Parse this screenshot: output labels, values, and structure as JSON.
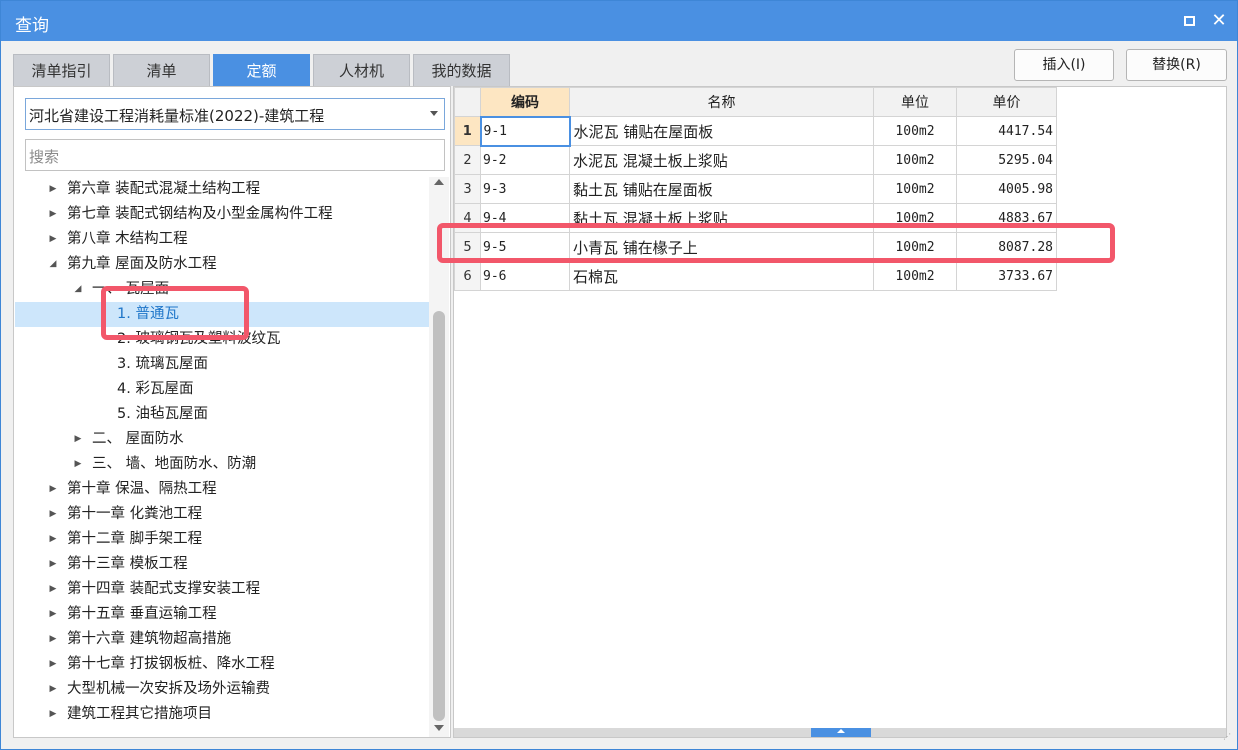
{
  "window": {
    "title": "查询",
    "maximize_icon": "maximize-icon",
    "close_icon": "close-icon",
    "close_glyph": "✕",
    "accent": "#4a90e2",
    "highlight_color": "#f2576a"
  },
  "tabs": [
    {
      "label": "清单指引",
      "active": false
    },
    {
      "label": "清单",
      "active": false
    },
    {
      "label": "定额",
      "active": true
    },
    {
      "label": "人材机",
      "active": false
    },
    {
      "label": "我的数据",
      "active": false
    }
  ],
  "buttons": {
    "insert": "插入(I)",
    "replace": "替换(R)"
  },
  "left": {
    "standard_select": "河北省建设工程消耗量标准(2022)-建筑工程",
    "search_placeholder": "搜索",
    "tree": [
      {
        "label": "第六章 装配式混凝土结构工程",
        "level": 0,
        "expanded": false
      },
      {
        "label": "第七章 装配式钢结构及小型金属构件工程",
        "level": 0,
        "expanded": false
      },
      {
        "label": "第八章 木结构工程",
        "level": 0,
        "expanded": false
      },
      {
        "label": "第九章 屋面及防水工程",
        "level": 0,
        "expanded": true
      },
      {
        "label": "一、 瓦屋面",
        "level": 1,
        "expanded": true
      },
      {
        "label": "1. 普通瓦",
        "level": 2,
        "selected": true
      },
      {
        "label": "2. 玻璃钢瓦及塑料波纹瓦",
        "level": 2
      },
      {
        "label": "3. 琉璃瓦屋面",
        "level": 2
      },
      {
        "label": "4. 彩瓦屋面",
        "level": 2
      },
      {
        "label": "5. 油毡瓦屋面",
        "level": 2
      },
      {
        "label": "二、 屋面防水",
        "level": 1,
        "expanded": false
      },
      {
        "label": "三、 墙、地面防水、防潮",
        "level": 1,
        "expanded": false
      },
      {
        "label": "第十章 保温、隔热工程",
        "level": 0,
        "expanded": false
      },
      {
        "label": "第十一章 化粪池工程",
        "level": 0,
        "expanded": false
      },
      {
        "label": "第十二章 脚手架工程",
        "level": 0,
        "expanded": false
      },
      {
        "label": "第十三章 模板工程",
        "level": 0,
        "expanded": false
      },
      {
        "label": "第十四章 装配式支撑安装工程",
        "level": 0,
        "expanded": false
      },
      {
        "label": "第十五章 垂直运输工程",
        "level": 0,
        "expanded": false
      },
      {
        "label": "第十六章 建筑物超高措施",
        "level": 0,
        "expanded": false
      },
      {
        "label": "第十七章 打拔钢板桩、降水工程",
        "level": 0,
        "expanded": false
      },
      {
        "label": "大型机械一次安拆及场外运输费",
        "level": 0,
        "expanded": false
      },
      {
        "label": "建筑工程其它措施项目",
        "level": 0,
        "expanded": false
      }
    ]
  },
  "table": {
    "headers": {
      "code": "编码",
      "name": "名称",
      "unit": "单位",
      "price": "单价"
    },
    "rows": [
      {
        "no": "1",
        "code": "9-1",
        "name": "水泥瓦 铺贴在屋面板",
        "unit": "100m2",
        "price": "4417.54"
      },
      {
        "no": "2",
        "code": "9-2",
        "name": "水泥瓦 混凝土板上浆贴",
        "unit": "100m2",
        "price": "5295.04"
      },
      {
        "no": "3",
        "code": "9-3",
        "name": "黏土瓦 铺贴在屋面板",
        "unit": "100m2",
        "price": "4005.98"
      },
      {
        "no": "4",
        "code": "9-4",
        "name": "黏土瓦 混凝土板上浆贴",
        "unit": "100m2",
        "price": "4883.67"
      },
      {
        "no": "5",
        "code": "9-5",
        "name": "小青瓦 铺在椽子上",
        "unit": "100m2",
        "price": "8087.28"
      },
      {
        "no": "6",
        "code": "9-6",
        "name": "石棉瓦",
        "unit": "100m2",
        "price": "3733.67"
      }
    ]
  }
}
